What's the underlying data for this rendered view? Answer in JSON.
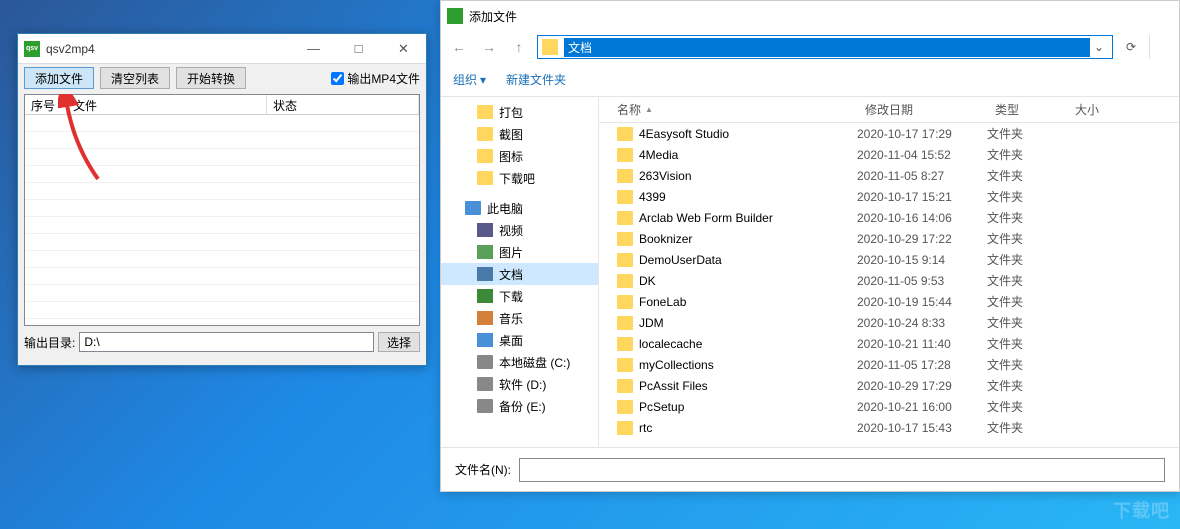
{
  "app": {
    "title": "qsv2mp4",
    "toolbar": {
      "add": "添加文件",
      "clear": "清空列表",
      "start": "开始转换",
      "out_mp4": "输出MP4文件",
      "out_mp4_checked": true
    },
    "grid": {
      "col_no": "序号",
      "col_file": "文件",
      "col_status": "状态"
    },
    "out_dir_label": "输出目录:",
    "out_dir_value": "D:\\",
    "browse": "选择"
  },
  "dialog": {
    "title": "添加文件",
    "path_text": "文档",
    "toolbar": {
      "organize": "组织",
      "newfolder": "新建文件夹"
    },
    "sidebar": {
      "quick": [
        {
          "label": "打包",
          "icon": "folder"
        },
        {
          "label": "截图",
          "icon": "folder"
        },
        {
          "label": "图标",
          "icon": "folder"
        },
        {
          "label": "下载吧",
          "icon": "folder"
        }
      ],
      "thispc": "此电脑",
      "pcitems": [
        {
          "label": "视频",
          "icon": "video"
        },
        {
          "label": "图片",
          "icon": "pics"
        },
        {
          "label": "文档",
          "icon": "docs",
          "selected": true
        },
        {
          "label": "下载",
          "icon": "dl"
        },
        {
          "label": "音乐",
          "icon": "music"
        },
        {
          "label": "桌面",
          "icon": "desk"
        },
        {
          "label": "本地磁盘 (C:)",
          "icon": "drive"
        },
        {
          "label": "软件 (D:)",
          "icon": "drive"
        },
        {
          "label": "备份 (E:)",
          "icon": "drive"
        }
      ]
    },
    "columns": {
      "name": "名称",
      "date": "修改日期",
      "type": "类型",
      "size": "大小"
    },
    "files": [
      {
        "name": "4Easysoft Studio",
        "date": "2020-10-17 17:29",
        "type": "文件夹"
      },
      {
        "name": "4Media",
        "date": "2020-11-04 15:52",
        "type": "文件夹"
      },
      {
        "name": "263Vision",
        "date": "2020-11-05 8:27",
        "type": "文件夹"
      },
      {
        "name": "4399",
        "date": "2020-10-17 15:21",
        "type": "文件夹"
      },
      {
        "name": "Arclab Web Form Builder",
        "date": "2020-10-16 14:06",
        "type": "文件夹"
      },
      {
        "name": "Booknizer",
        "date": "2020-10-29 17:22",
        "type": "文件夹"
      },
      {
        "name": "DemoUserData",
        "date": "2020-10-15 9:14",
        "type": "文件夹"
      },
      {
        "name": "DK",
        "date": "2020-11-05 9:53",
        "type": "文件夹"
      },
      {
        "name": "FoneLab",
        "date": "2020-10-19 15:44",
        "type": "文件夹"
      },
      {
        "name": "JDM",
        "date": "2020-10-24 8:33",
        "type": "文件夹"
      },
      {
        "name": "localecache",
        "date": "2020-10-21 11:40",
        "type": "文件夹"
      },
      {
        "name": "myCollections",
        "date": "2020-11-05 17:28",
        "type": "文件夹"
      },
      {
        "name": "PcAssit Files",
        "date": "2020-10-29 17:29",
        "type": "文件夹"
      },
      {
        "name": "PcSetup",
        "date": "2020-10-21 16:00",
        "type": "文件夹"
      },
      {
        "name": "rtc",
        "date": "2020-10-17 15:43",
        "type": "文件夹"
      }
    ],
    "filename_label": "文件名(N):"
  },
  "watermark": "下载吧"
}
